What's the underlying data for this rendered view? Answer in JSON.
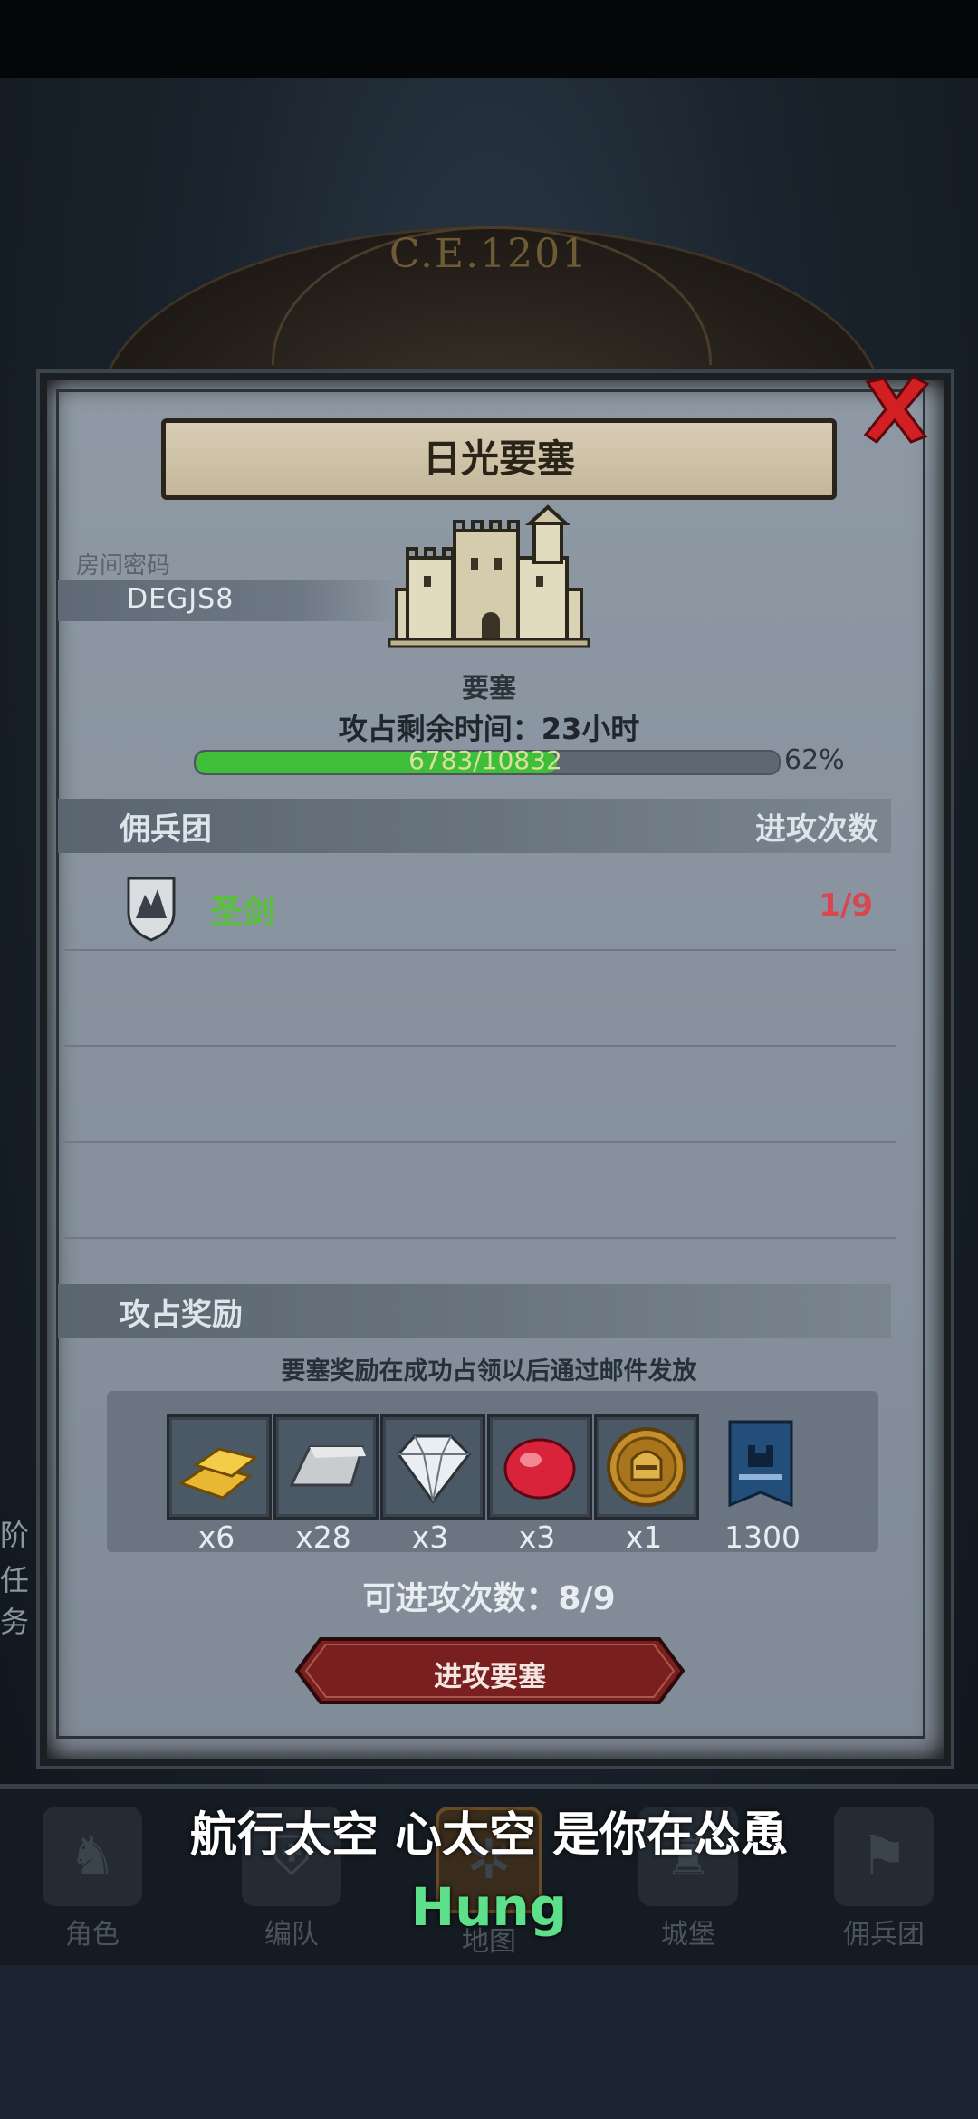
{
  "header": {
    "era_label": "C.E.1201"
  },
  "panel": {
    "title": "日光要塞",
    "room_code_label": "房间密码",
    "room_code": "DEGJS8",
    "building_label": "要塞",
    "time_remaining": "攻占剩余时间：23小时",
    "progress": {
      "text": "6783/10832",
      "percent_text": "62%",
      "fraction": 0.62
    },
    "mercenary_section": {
      "title": "佣兵团",
      "right_title": "进攻次数",
      "rows": [
        {
          "name": "圣剑",
          "attacks": "1/9"
        }
      ]
    },
    "reward_section": {
      "title": "攻占奖励",
      "note": "要塞奖励在成功占领以后通过邮件发放",
      "items": [
        {
          "icon": "gold-bar-icon",
          "count": "x6"
        },
        {
          "icon": "iron-ingot-icon",
          "count": "x28"
        },
        {
          "icon": "diamond-icon",
          "count": "x3"
        },
        {
          "icon": "ruby-icon",
          "count": "x3"
        },
        {
          "icon": "helmet-coin-icon",
          "count": "x1"
        },
        {
          "icon": "guild-banner-icon",
          "count": "1300"
        }
      ]
    },
    "attack_count_text": "可进攻次数：8/9",
    "attack_button_label": "进攻要塞"
  },
  "nav": {
    "items": [
      {
        "label": "角色"
      },
      {
        "label": "编队"
      },
      {
        "label": "地图"
      },
      {
        "label": "城堡"
      },
      {
        "label": "佣兵团"
      }
    ]
  },
  "side_peek": {
    "lines": [
      "阶",
      "任务"
    ]
  },
  "subtitles": {
    "chinese": "航行太空 心太空 是你在怂恿",
    "english": "Hung"
  },
  "colors": {
    "progress_fill": "#3fbf38",
    "merc_name": "#58c33a",
    "merc_count": "#d8474f",
    "subtitle_en": "#5ce08a",
    "close_x": "#d21f24"
  }
}
